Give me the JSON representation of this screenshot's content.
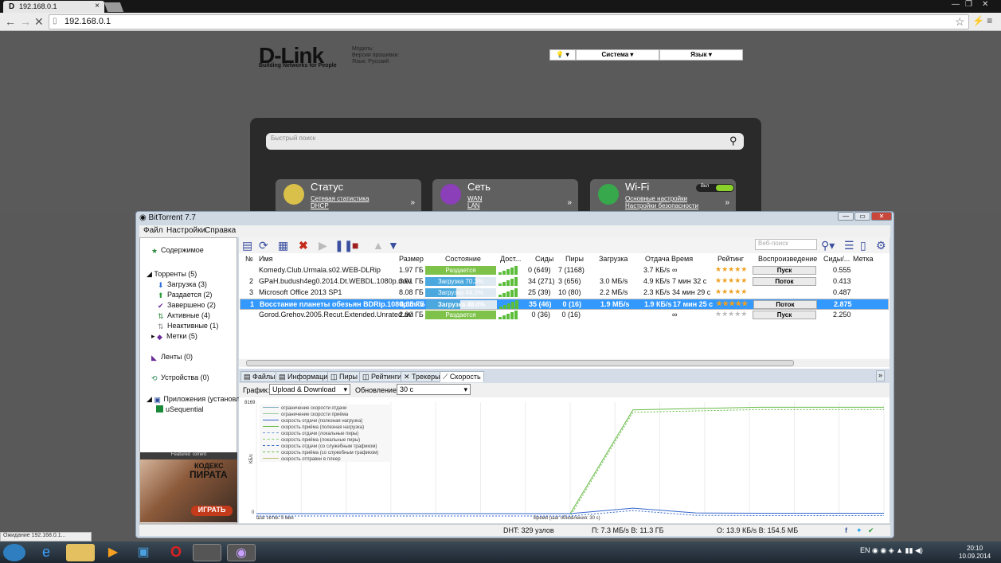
{
  "browser": {
    "tab_title": "192.168.0.1",
    "address": "192.168.0.1",
    "status_text": "Ожидание 192.168.0.1..."
  },
  "router": {
    "brand": "D-Link",
    "tagline": "Building Networks for People",
    "model_label": "Модель:",
    "fw_label": "Версия прошивки:",
    "lang_label": "Язык: Русский",
    "system_menu": "Система",
    "language_menu": "Язык",
    "search_placeholder": "Быстрый поиск",
    "tiles": [
      {
        "title": "Статус",
        "l1": "Сетевая статистика",
        "l2": "DHCP"
      },
      {
        "title": "Сеть",
        "l1": "WAN",
        "l2": "LAN"
      },
      {
        "title": "Wi-Fi",
        "l1": "Основные настройки",
        "l2": "Настройки безопасности"
      }
    ],
    "wifi_toggle": "Вкл"
  },
  "bt": {
    "title": "BitTorrent 7.7",
    "menu": [
      "Файл",
      "Настройки",
      "Справка"
    ],
    "web_search": "Веб-поиск",
    "sidebar": [
      "Содержимое",
      "Торренты (5)",
      "Загрузка (3)",
      "Раздается (2)",
      "Завершено (2)",
      "Активные (4)",
      "Неактивные (1)",
      "Метки (5)",
      "Ленты (0)",
      "Устройства (0)",
      "Приложения (установлен",
      "uSequential"
    ],
    "featured": {
      "label": "Featured Torrent",
      "t1": "КОДЕКС",
      "t2": "ПИРАТА",
      "btn": "ИГРАТЬ"
    },
    "headers": [
      "№",
      "Имя",
      "Размер",
      "Состояние",
      "Дост...",
      "Сиды",
      "Пиры",
      "Загрузка",
      "Отдача",
      "Время",
      "Рейтинг",
      "Воспроизведение",
      "Сиды/...",
      "Метка"
    ],
    "rows": [
      {
        "num": "",
        "name": "Komedy.Club.Urmala.s02.WEB-DLRip",
        "size": "1.97 ГБ",
        "state": "Раздается",
        "progress": 1.0,
        "seeds": "0 (649)",
        "peers": "7 (1168)",
        "down": "",
        "up": "3.7 КБ/s",
        "time": "∞",
        "stars": "★★★★★",
        "play": "Пуск",
        "ratio": "0.555"
      },
      {
        "num": "2",
        "name": "GPaH.budush4eg0.2014.Dt.WEBDL.1080p.mkv",
        "size": "3.91 ГБ",
        "state": "Загрузка 70.3%",
        "progress": 0.703,
        "seeds": "34 (271)",
        "peers": "3 (656)",
        "down": "3.0 МБ/s",
        "up": "4.9 КБ/s",
        "time": "7 мин 32 с",
        "stars": "★★★★★",
        "play": "Поток",
        "ratio": "0.413"
      },
      {
        "num": "3",
        "name": "Microsoft Office 2013 SP1",
        "size": "8.08 ГБ",
        "state": "Загрузка 44.3%",
        "progress": 0.443,
        "seeds": "25 (39)",
        "peers": "10 (80)",
        "down": "2.2 МБ/s",
        "up": "2.3 КБ/s",
        "time": "34 мин 29 с",
        "stars": "★★★★★",
        "play": "",
        "ratio": "0.487"
      },
      {
        "num": "1",
        "name": "Восстание планеты обезьян BDRip.1080p.mkv",
        "size": "4.35 ГБ",
        "state": "Загрузка 48.0%",
        "progress": 0.48,
        "seeds": "35 (46)",
        "peers": "0 (16)",
        "down": "1.9 МБ/s",
        "up": "1.9 КБ/s",
        "time": "17 мин 25 с",
        "stars": "★★★★★",
        "play": "Поток",
        "ratio": "2.875"
      },
      {
        "num": "",
        "name": "Gorod.Grehov.2005.Recut.Extended.Unrated.avi",
        "size": "2.90 ГБ",
        "state": "Раздается",
        "progress": 1.0,
        "seeds": "0 (36)",
        "peers": "0 (16)",
        "down": "",
        "up": "",
        "time": "∞",
        "stars": "★★★★★",
        "play": "Пуск",
        "ratio": "2.250"
      }
    ],
    "detail_tabs": [
      "Файлы",
      "Информация",
      "Пиры",
      "Рейтинги",
      "Трекеры",
      "Скорость"
    ],
    "graph_label": "График:",
    "graph_value": "Upload & Download",
    "update_label": "Обновление:",
    "update_value": "30 с",
    "legend": [
      "ограничение скорости отдачи",
      "ограничение скорости приёма",
      "скорость отдачи (полезная нагрузка)",
      "скорость приёма (полезная нагрузка)",
      "скорость отдачи (локальные пиры)",
      "скорость приёма (локальные пиры)",
      "скорость отдачи (со служебным трафиком)",
      "скорость приёма (со служебным трафиком)",
      "скорость отправки в плеер"
    ],
    "y_max": "8169",
    "y_min": "0",
    "y_unit": "КБ/с",
    "grid_step": "Шаг сетки: 5 мин",
    "time_step": "Время (шаг обновления: 30 с)",
    "status": {
      "dht": "DHT: 329 узлов",
      "down": "П: 7.3 МБ/s В: 11.3 ГБ",
      "up": "О: 13.9 КБ/s В: 154.5 МБ"
    }
  },
  "chart_data": {
    "type": "line",
    "x": [
      0,
      1,
      2,
      3,
      4,
      5,
      6,
      7,
      8,
      9,
      10
    ],
    "series": [
      {
        "name": "скорость приёма (со служебным трафиком)",
        "values": [
          0,
          0,
          0,
          0,
          0,
          0,
          7600,
          7700,
          7800,
          7800,
          7800
        ]
      },
      {
        "name": "скорость отдачи (со служебным трафиком)",
        "values": [
          0,
          0,
          0,
          0,
          0,
          0,
          400,
          50,
          30,
          30,
          30
        ]
      }
    ],
    "ylim": [
      0,
      8169
    ]
  },
  "taskbar": {
    "lang": "EN",
    "time": "20:10",
    "date": "10.09.2014"
  }
}
